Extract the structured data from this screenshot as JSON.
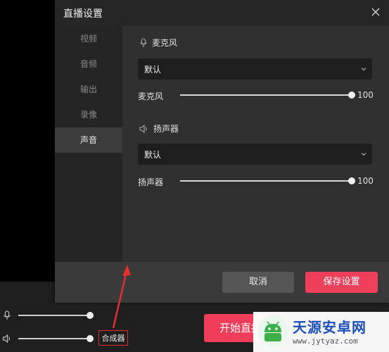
{
  "dialog": {
    "title": "直播设置",
    "sidebar": {
      "items": [
        {
          "label": "视频"
        },
        {
          "label": "音频"
        },
        {
          "label": "输出"
        },
        {
          "label": "录像"
        },
        {
          "label": "声音"
        }
      ],
      "active": "声音"
    },
    "mic": {
      "section_title": "麦克风",
      "device": "默认",
      "slider_label": "麦克风",
      "volume": "100"
    },
    "speaker": {
      "section_title": "扬声器",
      "device": "默认",
      "slider_label": "扬声器",
      "volume": "100"
    },
    "footer": {
      "cancel": "取消",
      "save": "保存设置"
    }
  },
  "bottom": {
    "mixer_label": "合成器",
    "start_live": "开始直播"
  },
  "watermark": {
    "name": "天源安卓网",
    "url": "www.jytyaz.com"
  },
  "colors": {
    "accent": "#ee3f5b",
    "annotation": "#e03030"
  },
  "icons": [
    "close-icon",
    "microphone-icon",
    "speaker-icon",
    "chevron-down-icon"
  ]
}
